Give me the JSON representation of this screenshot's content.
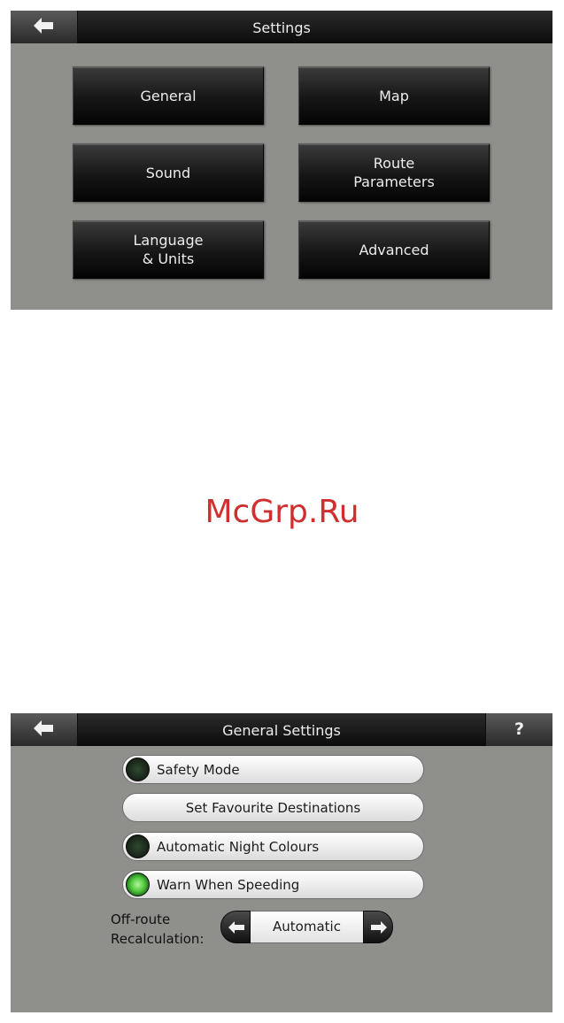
{
  "settings_screen": {
    "title": "Settings",
    "back_icon": "left-arrow-icon",
    "buttons": [
      {
        "label": "General"
      },
      {
        "label": "Map"
      },
      {
        "label": "Sound"
      },
      {
        "label": "Route\nParameters"
      },
      {
        "label": "Language\n& Units"
      },
      {
        "label": "Advanced"
      }
    ]
  },
  "watermark": "McGrp.Ru",
  "general_settings_screen": {
    "title": "General Settings",
    "back_icon": "left-arrow-icon",
    "help_label": "?",
    "options": [
      {
        "label": "Safety Mode",
        "indicator": "off"
      },
      {
        "label": "Set Favourite Destinations"
      },
      {
        "label": "Automatic Night Colours",
        "indicator": "off"
      },
      {
        "label": "Warn When Speeding",
        "indicator": "on"
      }
    ],
    "off_route": {
      "label": "Off-route\nRecalculation:",
      "value": "Automatic"
    }
  },
  "colors": {
    "panel_bg": "#8f8f8b",
    "indicator_on": "#4ec63a",
    "watermark": "#cf2f2f"
  }
}
